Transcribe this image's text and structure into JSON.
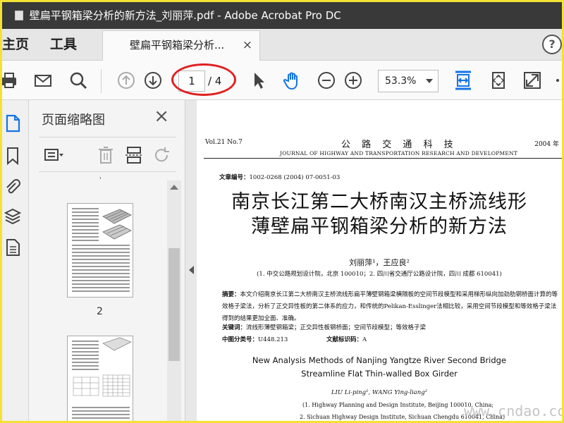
{
  "window": {
    "title": "壁扁平钢箱梁分析的新方法_刘丽萍.pdf - Adobe Acrobat Pro DC"
  },
  "nav": {
    "home": "主页",
    "tools": "工具",
    "tab_label": "壁扁平钢箱梁分析...",
    "tab_close": "×",
    "help": "?"
  },
  "toolbar": {
    "page_current": "1",
    "page_total": "/ 4",
    "zoom": "53.3%"
  },
  "panel": {
    "title": "页面缩略图",
    "close": "×",
    "thumb_label": "2",
    "tiny_mark": "'"
  },
  "document": {
    "volno": "Vol.21   No.7",
    "journal_title": "公 路 交 通 科 技",
    "year": "2004 年",
    "journal_en": "JOURNAL OF HIGHWAY AND TRANSPORTATION RESEARCH AND DEVELOPMENT",
    "article_no_label": "文章编号：",
    "article_no": "1002-0268 (2004) 07-0051-03",
    "title_line1": "南京长江第二大桥南汉主桥流线形",
    "title_line2": "薄壁扁平钢箱梁分析的新方法",
    "authors": "刘丽萍¹，王应良²",
    "affiliation": "(1. 中交公路规划设计院，北京   100010；2. 四川省交通厅公路设计院，四川   成都   610041)",
    "abstract_label": "摘要：",
    "abstract": "本文介绍南京长江第二大桥南汉主桥流线形扁平薄壁钢箱梁横隔板的空间节段模型和采用梯形纵向加劲肋钢桥面计算的等效格子梁法，分析了正交异性板的第二体系的应力，和传统的Pelikan-Esslinger法相比较，采用空间节段模型和等效格子梁法得到的结果更加全面、准确。",
    "keywords_label": "关键词：",
    "keywords": "流线形薄壁钢箱梁；正交异性板钢桥面；空间节段模型；等效格子梁",
    "cls_label": "中图分类号：",
    "cls": "U448.213",
    "doccode_label": "文献标识码：",
    "doccode": "A",
    "en_title_line1": "New Analysis Methods of Nanjing Yangtze River Second Bridge",
    "en_title_line2": "Streamline Flat Thin-walled Box Girder",
    "en_authors": "LIU Li-ping¹,   WANG Ying-liang²",
    "en_affil1": "(1. Highway Planning and Design Institute,  Beijing   100010,  China;",
    "en_affil2": "2. Sichuan Highway Design Institute,  Sichuan   Chengdu   610041,  China)"
  },
  "watermark": "www.cndao.com",
  "colors": {
    "accent": "#1473e6",
    "annotation": "#e02020",
    "frame": "#f3e233",
    "titlebar": "#393939"
  }
}
